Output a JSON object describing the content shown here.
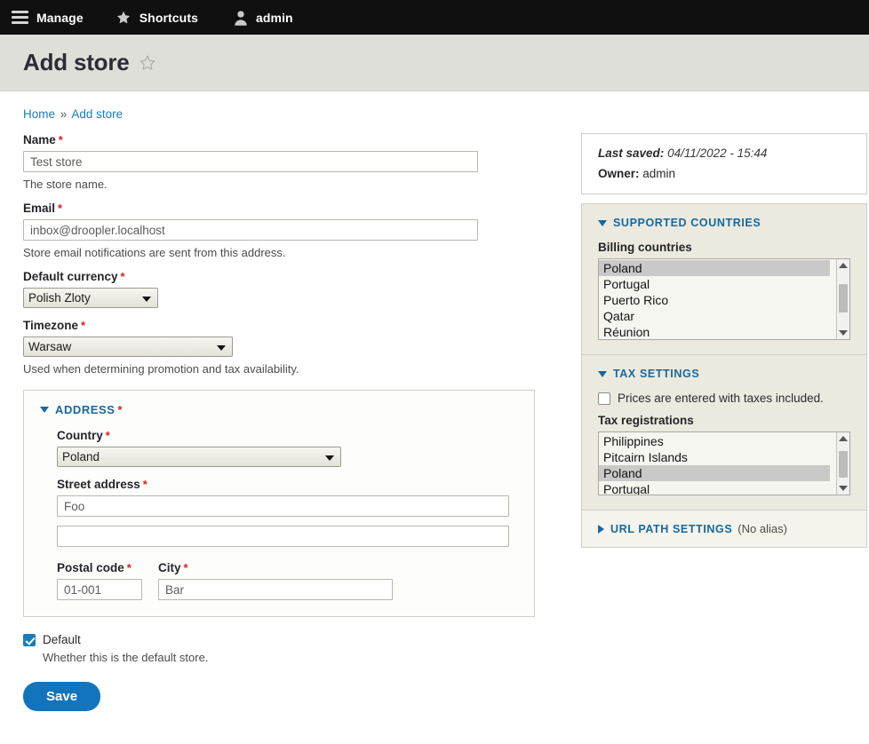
{
  "toolbar": {
    "items": [
      {
        "icon": "hamburger-menu-icon",
        "label": "Manage"
      },
      {
        "icon": "star-icon",
        "label": "Shortcuts"
      },
      {
        "icon": "user-account-icon",
        "label": "admin"
      }
    ]
  },
  "header": {
    "title": "Add store",
    "star_icon": "star-outline-icon"
  },
  "breadcrumb": {
    "home": "Home",
    "separator": "»",
    "current": "Add store"
  },
  "form": {
    "name": {
      "label": "Name",
      "required": "*",
      "value": "Test store",
      "description": "The store name."
    },
    "email": {
      "label": "Email",
      "required": "*",
      "value": "inbox@droopler.localhost",
      "description": "Store email notifications are sent from this address."
    },
    "currency": {
      "label": "Default currency",
      "required": "*",
      "value": "Polish Zloty"
    },
    "timezone": {
      "label": "Timezone",
      "required": "*",
      "value": "Warsaw",
      "description": "Used when determining promotion and tax availability."
    },
    "address": {
      "summary": "ADDRESS",
      "required": "*",
      "country": {
        "label": "Country",
        "required": "*",
        "value": "Poland"
      },
      "street": {
        "label": "Street address",
        "required": "*",
        "line1": "Foo",
        "line2": ""
      },
      "postal_code": {
        "label": "Postal code",
        "required": "*",
        "value": "01-001"
      },
      "city": {
        "label": "City",
        "required": "*",
        "value": "Bar"
      }
    },
    "default_store": {
      "label": "Default",
      "checked": true,
      "description": "Whether this is the default store."
    },
    "save_button": "Save"
  },
  "sidebar": {
    "meta": {
      "last_saved_label": "Last saved:",
      "last_saved_value": "04/11/2022 - 15:44",
      "owner_label": "Owner:",
      "owner_value": "admin"
    },
    "supported_countries": {
      "summary": "SUPPORTED COUNTRIES",
      "billing_label": "Billing countries",
      "options": [
        {
          "label": "Poland",
          "selected": true
        },
        {
          "label": "Portugal",
          "selected": false
        },
        {
          "label": "Puerto Rico",
          "selected": false
        },
        {
          "label": "Qatar",
          "selected": false
        },
        {
          "label": "Réunion",
          "selected": false
        }
      ]
    },
    "tax_settings": {
      "summary": "TAX SETTINGS",
      "prices_checkbox": {
        "label": "Prices are entered with taxes included.",
        "checked": false
      },
      "registrations_label": "Tax registrations",
      "options": [
        {
          "label": "Philippines",
          "selected": false
        },
        {
          "label": "Pitcairn Islands",
          "selected": false
        },
        {
          "label": "Poland",
          "selected": true
        },
        {
          "label": "Portugal",
          "selected": false
        }
      ]
    },
    "url_path": {
      "summary": "URL PATH SETTINGS",
      "status": "(No alias)"
    }
  },
  "colors": {
    "toolbar_bg": "#101010",
    "header_bg": "#dedfd8",
    "link": "#1b7bbd",
    "accent": "#17689e",
    "required": "#d72222",
    "button": "#1274bd",
    "selected_option": "#c9c9c9"
  }
}
